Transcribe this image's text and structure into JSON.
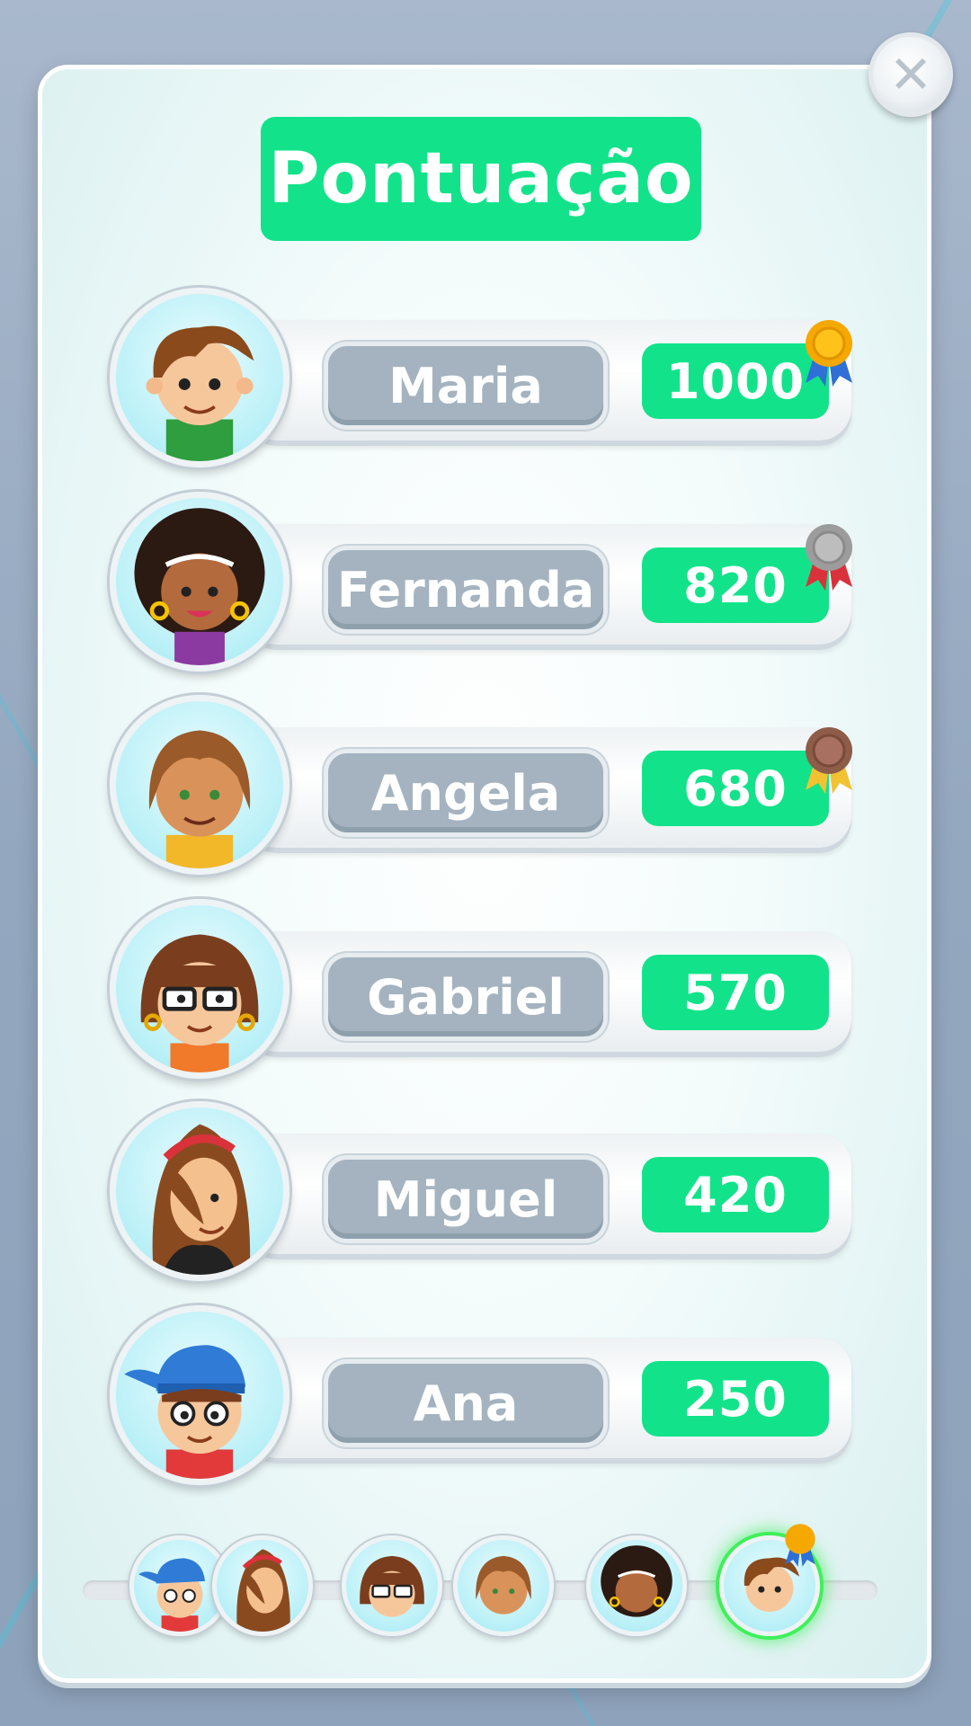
{
  "title": "Pontuação",
  "close_icon": "close-icon",
  "colors": {
    "accent_green": "#12e38a",
    "name_pill": "#a4b3bf",
    "gold": "#f5a800",
    "silver": "#a9a9a9",
    "bronze": "#a0705a"
  },
  "players": [
    {
      "name": "Maria",
      "score": "1000",
      "medal": "gold"
    },
    {
      "name": "Fernanda",
      "score": "820",
      "medal": "silver"
    },
    {
      "name": "Angela",
      "score": "680",
      "medal": "bronze"
    },
    {
      "name": "Gabriel",
      "score": "570",
      "medal": ""
    },
    {
      "name": "Miguel",
      "score": "420",
      "medal": ""
    },
    {
      "name": "Ana",
      "score": "250",
      "medal": ""
    }
  ],
  "progress_track": {
    "avatars": [
      "ana-avatar",
      "miguel-avatar",
      "gabriel-avatar",
      "angela-avatar",
      "fernanda-avatar",
      "maria-avatar"
    ],
    "active": "maria-avatar"
  }
}
